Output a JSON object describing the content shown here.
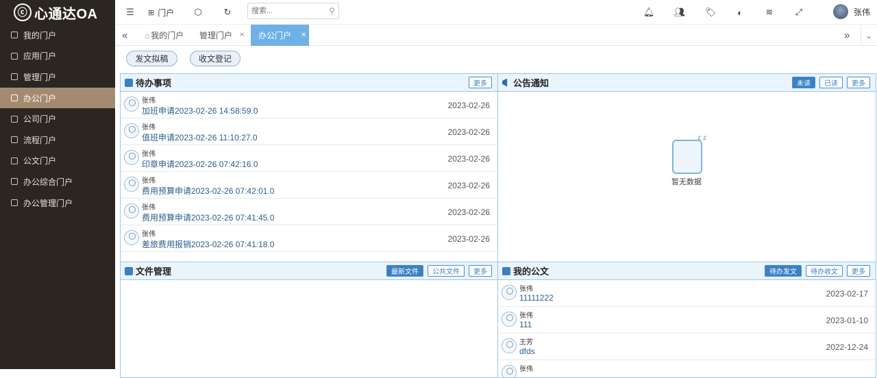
{
  "app": {
    "logo_mark": "ⓒ",
    "title": "心通达OA"
  },
  "sidebar": {
    "items": [
      {
        "label": "我的门户",
        "active": false
      },
      {
        "label": "应用门户",
        "active": false
      },
      {
        "label": "管理门户",
        "active": false
      },
      {
        "label": "办公门户",
        "active": true
      },
      {
        "label": "公司门户",
        "active": false
      },
      {
        "label": "流程门户",
        "active": false
      },
      {
        "label": "公文门户",
        "active": false
      },
      {
        "label": "办公综合门户",
        "active": false
      },
      {
        "label": "办公管理门户",
        "active": false
      }
    ]
  },
  "topbar": {
    "portal_label": "门户",
    "search_placeholder": "搜索...",
    "user_name": "张伟",
    "icons": [
      "menu-icon",
      "portal-icon",
      "cube-icon",
      "refresh-icon",
      "search-icon",
      "bell-icon",
      "contacts-icon",
      "tag-icon",
      "theme-icon",
      "layers-icon",
      "fullscreen-icon"
    ]
  },
  "tabs": [
    {
      "label": "我的门户",
      "closable": false,
      "active": false
    },
    {
      "label": "管理门户",
      "closable": true,
      "active": false
    },
    {
      "label": "办公门户",
      "closable": true,
      "active": true
    }
  ],
  "actions": {
    "draft": "发文拟稿",
    "register": "收文登记"
  },
  "todo": {
    "title": "待办事项",
    "more": "更多",
    "items": [
      {
        "user": "张伟",
        "title": "加班申请2023-02-26 14:58:59.0",
        "date": "2023-02-26"
      },
      {
        "user": "张伟",
        "title": "值班申请2023-02-26 11:10:27.0",
        "date": "2023-02-26"
      },
      {
        "user": "张伟",
        "title": "印章申请2023-02-26 07:42:16.0",
        "date": "2023-02-26"
      },
      {
        "user": "张伟",
        "title": "费用预算申请2023-02-26 07:42:01.0",
        "date": "2023-02-26"
      },
      {
        "user": "张伟",
        "title": "费用预算申请2023-02-26 07:41:45.0",
        "date": "2023-02-26"
      },
      {
        "user": "张伟",
        "title": "差旅费用报销2023-02-26 07:41:18.0",
        "date": "2023-02-26"
      }
    ]
  },
  "notice": {
    "title": "公告通知",
    "unread": "未读",
    "read": "已读",
    "more": "更多",
    "empty_text": "暂无数据"
  },
  "files": {
    "title": "文件管理",
    "latest": "最新文件",
    "public": "公共文件",
    "more": "更多"
  },
  "mydocs": {
    "title": "我的公文",
    "todo_send": "待办发文",
    "todo_receive": "待办收文",
    "more": "更多",
    "items": [
      {
        "user": "张伟",
        "title": "11111222",
        "date": "2023-02-17"
      },
      {
        "user": "张伟",
        "title": "111",
        "date": "2023-01-10"
      },
      {
        "user": "王芳",
        "title": "dfds",
        "date": "2022-12-24"
      },
      {
        "user": "张伟",
        "title": "",
        "date": ""
      }
    ]
  }
}
